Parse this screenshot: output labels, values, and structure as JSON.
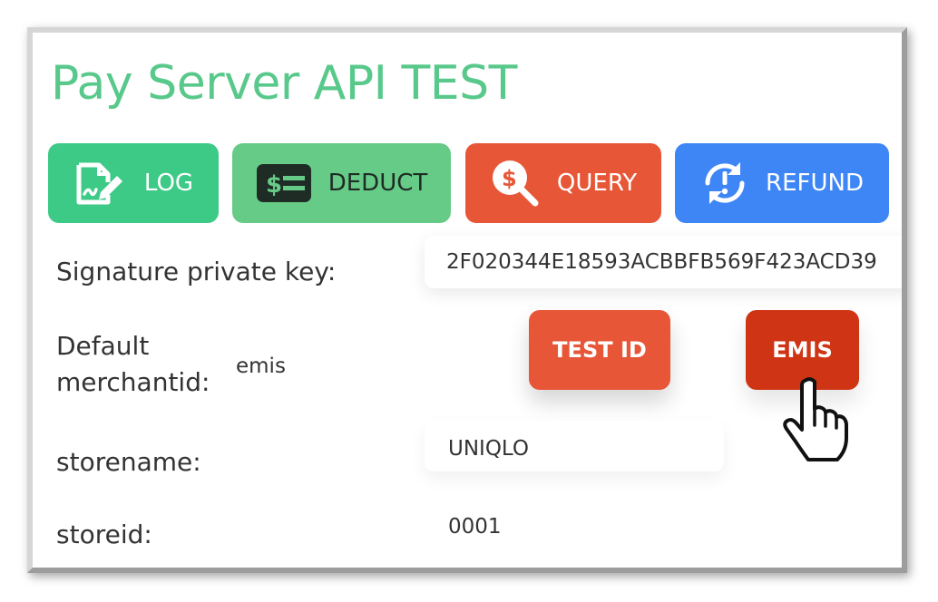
{
  "page": {
    "title": "Pay Server API TEST"
  },
  "toolbar": {
    "log": {
      "label": "LOG",
      "icon": "document-sign-icon",
      "color": "#3dca86"
    },
    "deduct": {
      "label": "DEDUCT",
      "icon": "money-deduct-icon",
      "color": "#66cb87"
    },
    "query": {
      "label": "QUERY",
      "icon": "money-search-icon",
      "color": "#e75637"
    },
    "refund": {
      "label": "REFUND",
      "icon": "refund-cycle-icon",
      "color": "#3e86f5"
    }
  },
  "form": {
    "signature_key": {
      "label": "Signature private key:",
      "value": "2F020344E18593ACBBFB569F423ACD39"
    },
    "merchant": {
      "label": "Default merchantid:",
      "value": "emis"
    },
    "storename": {
      "label": "storename:",
      "value": "UNIQLO"
    },
    "storeid": {
      "label": "storeid:",
      "value": "0001"
    }
  },
  "actions": {
    "test_id": {
      "label": "TEST ID",
      "color": "#e75637"
    },
    "emis": {
      "label": "EMIS",
      "color": "#cf3515"
    }
  },
  "cursor": {
    "icon": "hand-pointer-icon"
  }
}
